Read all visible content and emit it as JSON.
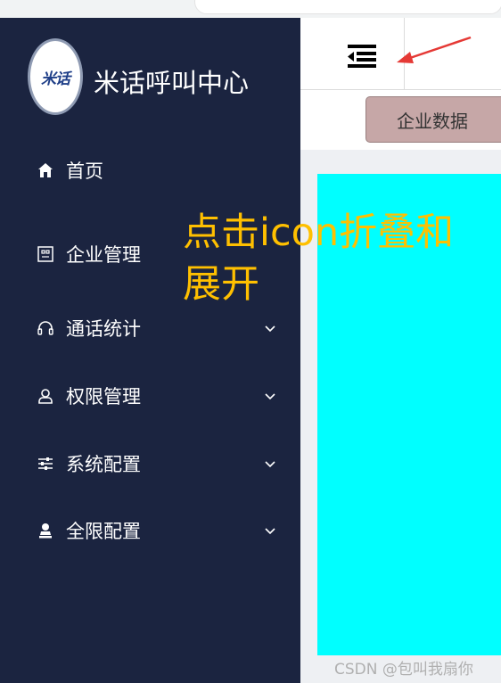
{
  "brand": {
    "logo_text": "米话",
    "title": "米话呼叫中心"
  },
  "sidebar": {
    "items": [
      {
        "label": "首页",
        "icon": "home-icon",
        "has_submenu": false
      },
      {
        "label": "企业管理",
        "icon": "building-icon",
        "has_submenu": false
      },
      {
        "label": "通话统计",
        "icon": "headset-icon",
        "has_submenu": true
      },
      {
        "label": "权限管理",
        "icon": "user-icon",
        "has_submenu": true
      },
      {
        "label": "系统配置",
        "icon": "sliders-icon",
        "has_submenu": true
      },
      {
        "label": "全限配置",
        "icon": "person-icon",
        "has_submenu": true
      }
    ]
  },
  "header": {
    "toggle_icon": "menu-fold-icon"
  },
  "tabs": [
    {
      "label": "企业数据"
    }
  ],
  "annotation": {
    "text": "点击icon折叠和展开"
  },
  "watermark": "CSDN @包叫我扇你",
  "colors": {
    "sidebar_bg": "#1b2440",
    "content_panel": "#00ffff",
    "annotation": "#ffc000",
    "tab_bg": "#c6a7a7",
    "arrow": "#e53935"
  }
}
